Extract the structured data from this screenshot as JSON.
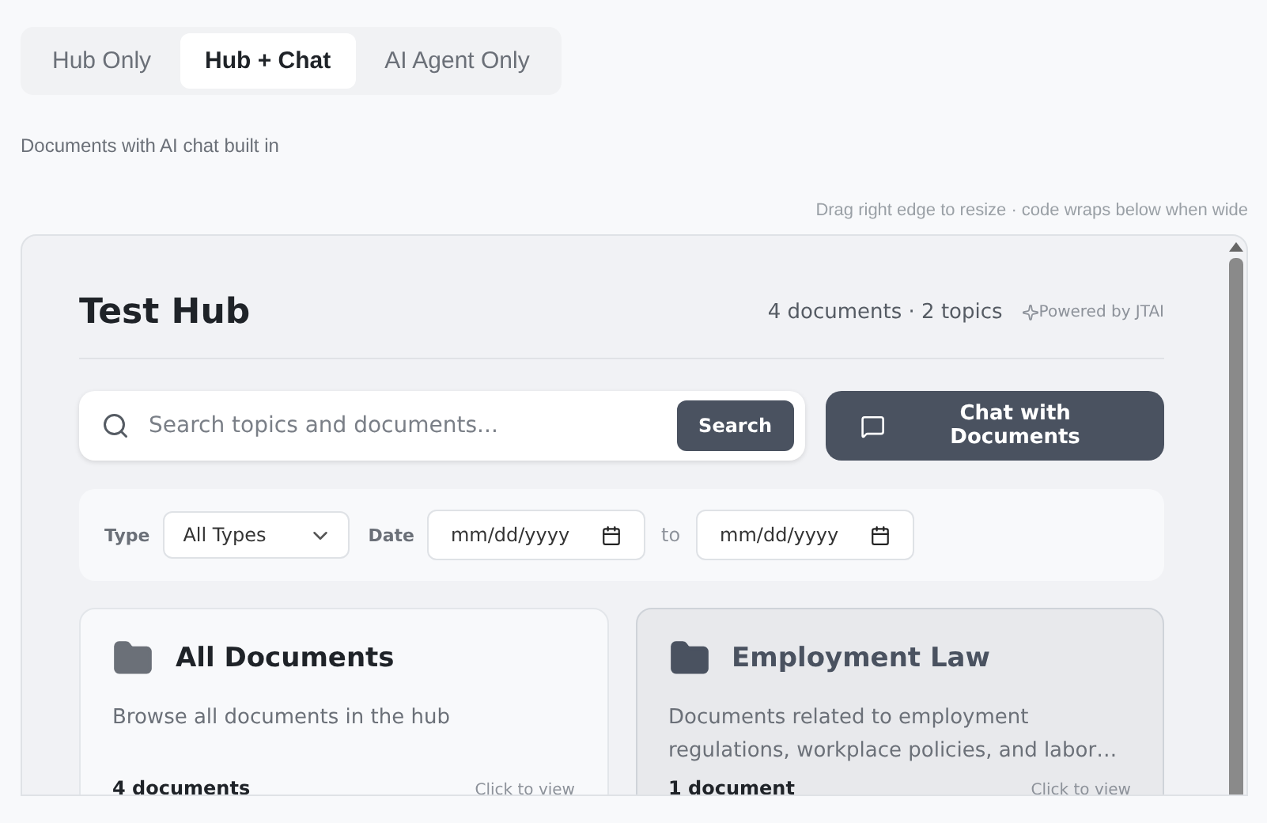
{
  "mode_tabs": [
    {
      "label": "Hub Only",
      "selected": false
    },
    {
      "label": "Hub + Chat",
      "selected": true
    },
    {
      "label": "AI Agent Only",
      "selected": false
    }
  ],
  "caption": "Documents with AI chat built in",
  "resize_hint": "Drag right edge to resize · code wraps below when wide",
  "hub": {
    "title": "Test Hub",
    "stats": "4 documents · 2 topics",
    "powered_by": "Powered by JTAI",
    "search": {
      "placeholder": "Search topics and documents...",
      "button": "Search"
    },
    "chat_button": "Chat with Documents",
    "filters": {
      "type_label": "Type",
      "type_value": "All Types",
      "date_label": "Date",
      "date_from": "mm/dd/yyyy",
      "to_label": "to",
      "date_to": "mm/dd/yyyy"
    },
    "topics": [
      {
        "title": "All Documents",
        "description": "Browse all documents in the hub",
        "count": "4 documents",
        "action": "Click to view",
        "selected": false
      },
      {
        "title": "Employment Law",
        "description": "Documents related to employment regulations, workplace policies, and labor…",
        "count": "1 document",
        "action": "Click to view",
        "selected": true
      }
    ]
  }
}
